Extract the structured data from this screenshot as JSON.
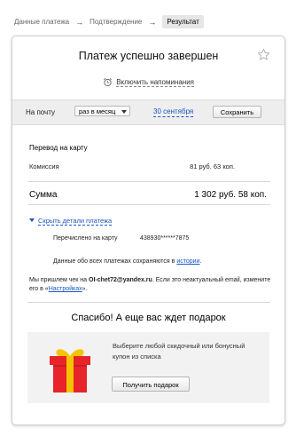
{
  "breadcrumbs": [
    "Данные платежа",
    "Подтверждение",
    "Результат"
  ],
  "title": "Платеж успешно завершен",
  "reminders": {
    "label": "Включить напоминания"
  },
  "schedule": {
    "label": "На почту",
    "frequency": "раз в месяц",
    "date": "30 сентября",
    "save": "Сохранить"
  },
  "payment": {
    "type": "Перевод на карту",
    "commission_label": "Комиссия",
    "commission_value": "81 руб. 63 коп.",
    "total_label": "Сумма",
    "total_value": "1 302 руб. 58 коп.",
    "details_toggle": "Скрыть детали платежа",
    "credited_label": "Перечислено на карту",
    "credited_value": "438930******7875"
  },
  "history_note": {
    "text": "Данные обо всех платежах сохраняются в",
    "link": "истории",
    "suffix": "."
  },
  "email_note": {
    "prefix": "Мы пришлем чек на",
    "email": "OI-chet72@yandex.ru",
    "middle": ". Если это неактуальный email, измените его в «",
    "link": "Настройках",
    "suffix": "»."
  },
  "gift": {
    "title": "Спасибо! А еще вас ждет подарок",
    "text": "Выберите любой скидочный или бонусный купон из списка",
    "button": "Получить подарок"
  },
  "colors": {
    "link": "#1a55c8",
    "gift_red": "#e8232a",
    "gift_ribbon": "#f5c400"
  }
}
